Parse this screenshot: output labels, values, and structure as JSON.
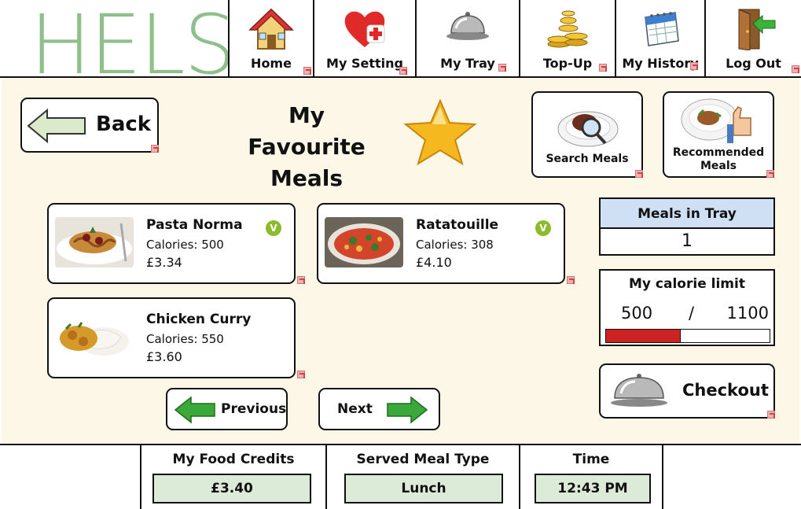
{
  "header": {
    "logo_text": "HELS",
    "nav": [
      {
        "label": "Home",
        "icon": "house-icon"
      },
      {
        "label": "My Setting",
        "icon": "heart-plus-icon"
      },
      {
        "label": "My Tray",
        "icon": "cloche-icon"
      },
      {
        "label": "Top-Up",
        "icon": "coins-icon"
      },
      {
        "label": "My History",
        "icon": "calendar-icon"
      },
      {
        "label": "Log Out",
        "icon": "door-exit-icon"
      }
    ]
  },
  "main": {
    "back_label": "Back",
    "title_line1": "My Favourite",
    "title_line2": "Meals",
    "search_label": "Search Meals",
    "recommended_label_line1": "Recommended",
    "recommended_label_line2": "Meals",
    "meals": [
      {
        "name": "Pasta Norma",
        "calories": "Calories: 500",
        "price": "£3.34",
        "vegetarian": "V"
      },
      {
        "name": "Ratatouille",
        "calories": "Calories: 308",
        "price": "£4.10",
        "vegetarian": "V"
      },
      {
        "name": "Chicken Curry",
        "calories": "Calories: 550",
        "price": "£3.60",
        "vegetarian": ""
      }
    ],
    "previous_label": "Previous",
    "next_label": "Next",
    "tray": {
      "heading": "Meals in Tray",
      "count": "1"
    },
    "calorie_limit": {
      "heading": "My calorie limit",
      "current": "500",
      "separator": "/",
      "limit": "1100",
      "fraction": 0.4545
    },
    "checkout_label": "Checkout"
  },
  "footer": {
    "credits_heading": "My Food Credits",
    "credits_value": "£3.40",
    "meal_type_heading": "Served Meal Type",
    "meal_type_value": "Lunch",
    "time_heading": "Time",
    "time_value": "12:43 PM"
  },
  "colors": {
    "background": "#fdf7e8",
    "accent_green": "#8fbf8a",
    "veg_badge": "#8cbb2c",
    "calorie_bar": "#cc2222",
    "tray_header": "#cfe0f5",
    "footer_box": "#dcebd8"
  }
}
